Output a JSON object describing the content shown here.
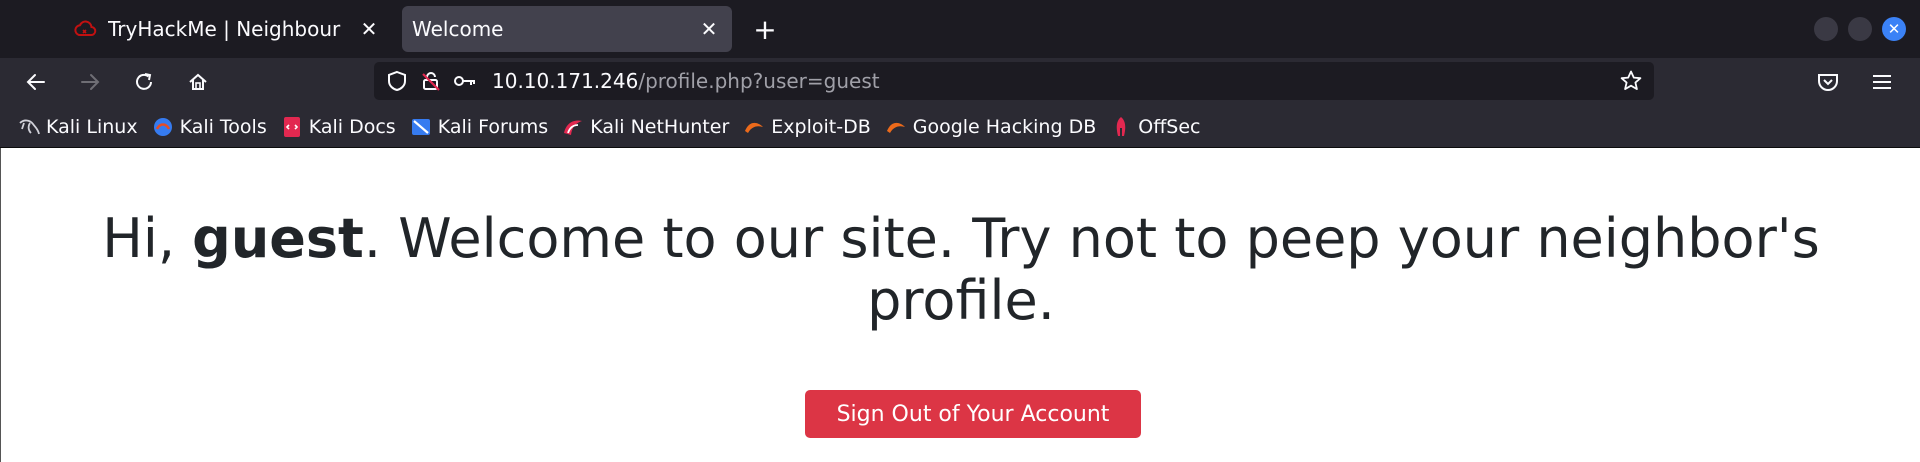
{
  "browser": {
    "tabs": [
      {
        "title": "TryHackMe | Neighbour",
        "icon": "tryhackme-cloud-icon",
        "active": false
      },
      {
        "title": "Welcome",
        "icon": "",
        "active": true
      }
    ],
    "url": {
      "host": "10.10.171.246",
      "path": "/profile.php?user=guest"
    },
    "bookmarks": [
      {
        "label": "Kali Linux",
        "icon": "kali-dragon-icon"
      },
      {
        "label": "Kali Tools",
        "icon": "kali-tools-icon"
      },
      {
        "label": "Kali Docs",
        "icon": "kali-docs-icon"
      },
      {
        "label": "Kali Forums",
        "icon": "kali-forums-icon"
      },
      {
        "label": "Kali NetHunter",
        "icon": "kali-nethunter-icon"
      },
      {
        "label": "Exploit-DB",
        "icon": "exploit-db-icon"
      },
      {
        "label": "Google Hacking DB",
        "icon": "google-hacking-db-icon"
      },
      {
        "label": "OffSec",
        "icon": "offsec-icon"
      }
    ],
    "accent": "#3b82f6"
  },
  "page": {
    "greeting_prefix": "Hi, ",
    "username": "guest",
    "greeting_suffix": ". Welcome to our site. Try not to peep your neighbor's profile.",
    "signout_label": "Sign Out of Your Account",
    "signout_color": "#dc3545"
  }
}
